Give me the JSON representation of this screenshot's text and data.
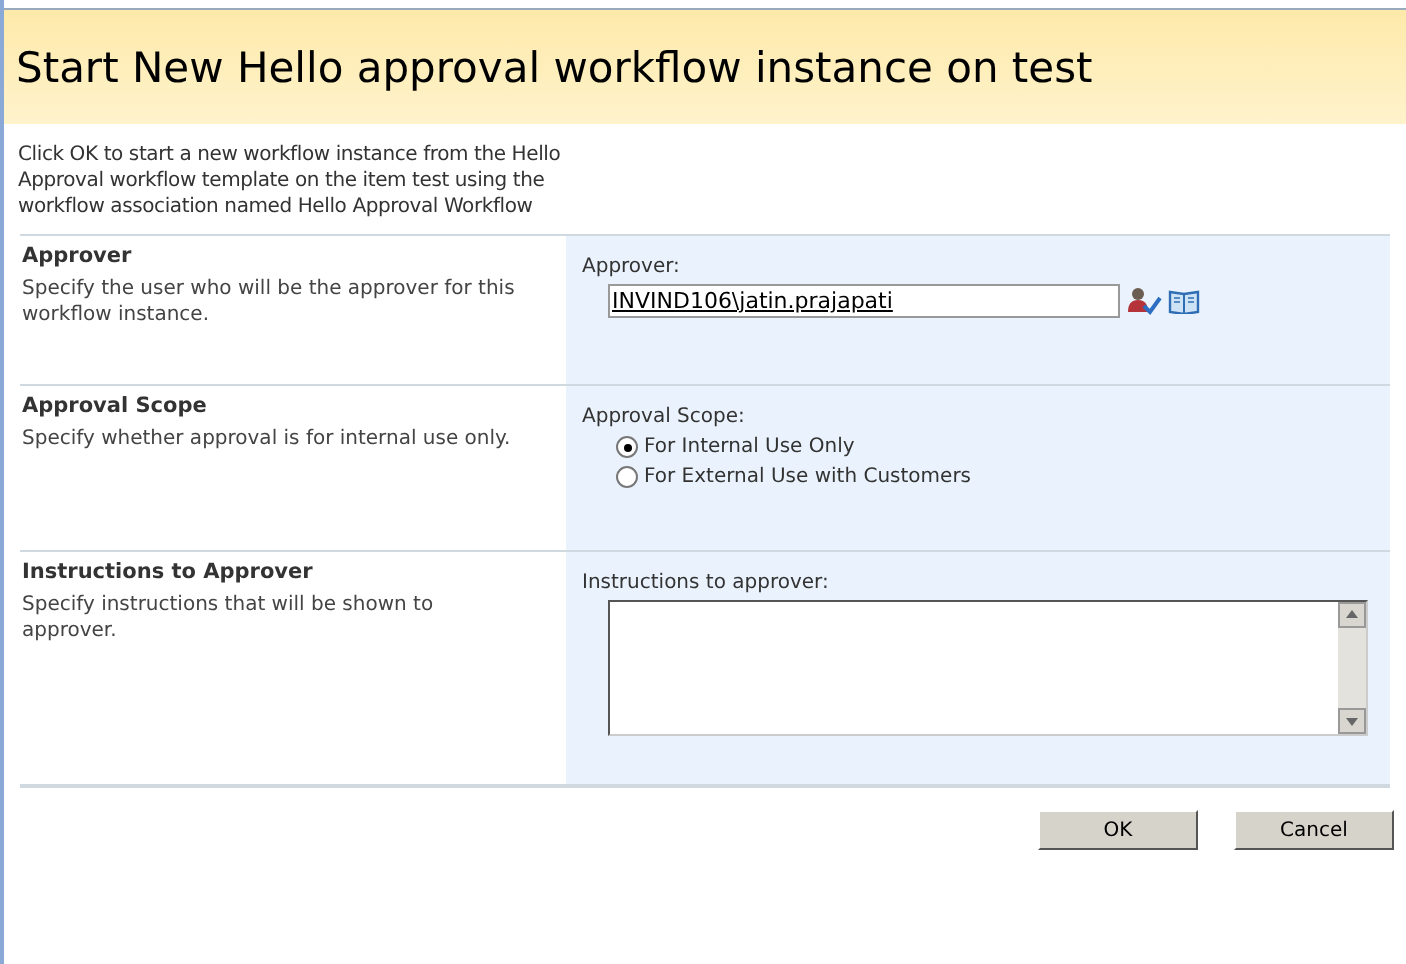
{
  "title": "Start New Hello approval workflow instance on test",
  "intro": "Click OK to start a new workflow instance from the Hello Approval workflow template on the item test using the workflow association named Hello Approval Workflow",
  "sections": [
    {
      "kind": "people",
      "heading": "Approver",
      "description": "Specify the user who will be the approver for this workflow instance.",
      "label": "Approver:",
      "value": "INVIND106\\jatin.prajapati"
    },
    {
      "kind": "radio",
      "heading": "Approval Scope",
      "description": "Specify whether approval is for internal use only.",
      "label": "Approval Scope:",
      "options": [
        {
          "label": "For Internal Use Only",
          "selected": true
        },
        {
          "label": "For External Use with Customers",
          "selected": false
        }
      ]
    },
    {
      "kind": "textarea",
      "heading": "Instructions to Approver",
      "description": "Specify instructions that will be shown to approver.",
      "label": "Instructions to approver:"
    }
  ],
  "buttons": [
    "OK",
    "Cancel"
  ]
}
